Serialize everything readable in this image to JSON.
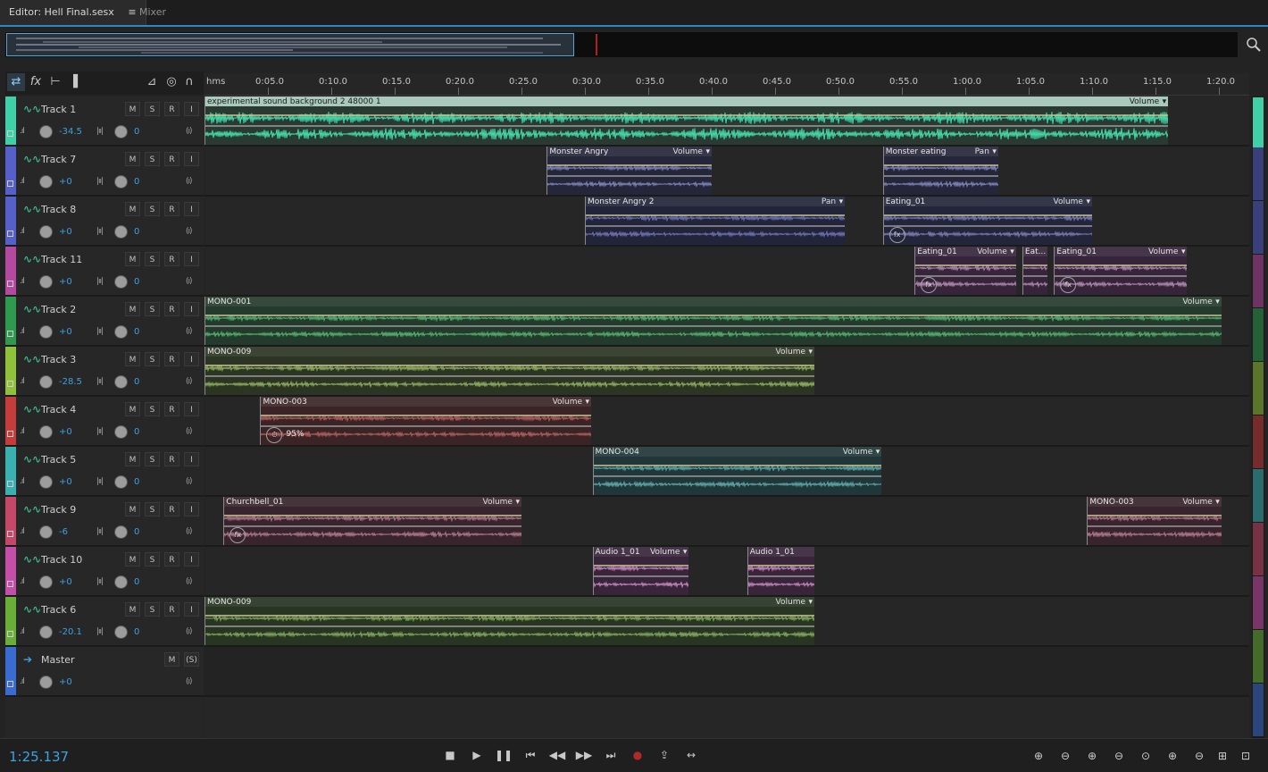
{
  "tabs": [
    {
      "label": "Editor: Hell Final.sesx",
      "active": true
    },
    {
      "label": "Mixer",
      "active": false
    }
  ],
  "tab_menu_icon": "hamburger-icon",
  "ruler": {
    "unit": "hms",
    "ticks": [
      "0:05.0",
      "0:10.0",
      "0:15.0",
      "0:20.0",
      "0:25.0",
      "0:30.0",
      "0:35.0",
      "0:40.0",
      "0:45.0",
      "0:50.0",
      "0:55.0",
      "1:00.0",
      "1:05.0",
      "1:10.0",
      "1:15.0",
      "1:20.0"
    ]
  },
  "track_header_buttons": {
    "mute": "M",
    "solo": "S",
    "record": "R",
    "input": "I"
  },
  "tracks": [
    {
      "name": "Track 1",
      "color": "#3fd0a7",
      "volume": "-34.5",
      "pan": "0",
      "clips": [
        {
          "title": "experimental sound background 2 48000 1",
          "param": "Volume",
          "start": 0.0,
          "end": 76.0,
          "fill": "#2a3a33",
          "wave": "#44dba8",
          "strong": true
        }
      ]
    },
    {
      "name": "Track 7",
      "color": "#5560c8",
      "volume": "+0",
      "pan": "0",
      "clips": [
        {
          "title": "Monster Angry",
          "param": "Volume",
          "start": 27.0,
          "end": 40.0,
          "fill": "#25263a",
          "wave": "#8286b8"
        },
        {
          "title": "Monster eating",
          "param": "Pan",
          "start": 53.5,
          "end": 62.6,
          "fill": "#25263a",
          "wave": "#8286b8"
        }
      ]
    },
    {
      "name": "Track 8",
      "color": "#5560c8",
      "volume": "+0",
      "pan": "0",
      "clips": [
        {
          "title": "Monster Angry 2",
          "param": "Pan",
          "start": 30.0,
          "end": 50.5,
          "fill": "#22243a",
          "wave": "#6e73b0"
        },
        {
          "title": "Eating_01",
          "param": "Volume",
          "start": 53.5,
          "end": 70.0,
          "fill": "#23253a",
          "wave": "#7a7eb0",
          "fx": true
        }
      ]
    },
    {
      "name": "Track 11",
      "color": "#b34aa0",
      "volume": "+0",
      "pan": "0",
      "clips": [
        {
          "title": "Eating_01",
          "param": "Volume",
          "start": 56.0,
          "end": 64.0,
          "fill": "#36253a",
          "wave": "#b08aae",
          "fx": true
        },
        {
          "title": "Eat...",
          "param": "",
          "start": 64.5,
          "end": 66.5,
          "fill": "#36253a",
          "wave": "#b08aae"
        },
        {
          "title": "Eating_01",
          "param": "Volume",
          "start": 67.0,
          "end": 77.5,
          "fill": "#36253a",
          "wave": "#b08aae",
          "fx": true
        }
      ]
    },
    {
      "name": "Track 2",
      "color": "#2f9a4f",
      "volume": "+0",
      "pan": "0",
      "clips": [
        {
          "title": "MONO-001",
          "param": "Volume",
          "start": 0.0,
          "end": 80.2,
          "fill": "#243a2c",
          "wave": "#56b072"
        }
      ]
    },
    {
      "name": "Track 3",
      "color": "#8fc23a",
      "volume": "-28.5",
      "pan": "0",
      "clips": [
        {
          "title": "MONO-009",
          "param": "Volume",
          "start": 0.0,
          "end": 48.1,
          "fill": "#2c3524",
          "wave": "#8fb060"
        }
      ]
    },
    {
      "name": "Track 4",
      "color": "#c43c3c",
      "volume": "+0",
      "pan": "0",
      "clips": [
        {
          "title": "MONO-003",
          "param": "Volume",
          "start": 4.4,
          "end": 30.5,
          "fill": "#3b2426",
          "wave": "#b06060",
          "stretch": "95%"
        }
      ]
    },
    {
      "name": "Track 5",
      "color": "#3ab0b0",
      "volume": "+0",
      "pan": "0",
      "clips": [
        {
          "title": "MONO-004",
          "param": "Volume",
          "start": 30.6,
          "end": 53.4,
          "fill": "#213638",
          "wave": "#5fa8a8"
        }
      ]
    },
    {
      "name": "Track 9",
      "color": "#c4486a",
      "volume": "-6",
      "pan": "0",
      "clips": [
        {
          "title": "Churchbell_01",
          "param": "Volume",
          "start": 1.5,
          "end": 25.0,
          "fill": "#38242c",
          "wave": "#b07888",
          "fx": true
        },
        {
          "title": "MONO-003",
          "param": "Volume",
          "start": 69.6,
          "end": 80.2,
          "fill": "#38242c",
          "wave": "#b07888"
        }
      ]
    },
    {
      "name": "Track 10",
      "color": "#c44fa8",
      "volume": "+0",
      "pan": "0",
      "clips": [
        {
          "title": "Audio 1_01",
          "param": "Volume",
          "start": 30.6,
          "end": 38.2,
          "fill": "#38253a",
          "wave": "#c88abd"
        },
        {
          "title": "Audio 1_01",
          "param": "",
          "start": 42.8,
          "end": 48.1,
          "fill": "#38253a",
          "wave": "#c88abd"
        }
      ]
    },
    {
      "name": "Track 6",
      "color": "#6aae3a",
      "volume": "-20.1",
      "pan": "0",
      "clips": [
        {
          "title": "MONO-009",
          "param": "Volume",
          "start": 0.0,
          "end": 48.1,
          "fill": "#283522",
          "wave": "#84a860"
        }
      ]
    }
  ],
  "master": {
    "name": "Master",
    "color": "#3a6bd0",
    "volume": "+0",
    "mute": "M",
    "solo": "(S)"
  },
  "timecode": "1:25.137",
  "transport_icons": [
    "stop-icon",
    "play-icon",
    "pause-icon",
    "go-to-start-icon",
    "rewind-icon",
    "fast-forward-icon",
    "go-to-end-icon",
    "record-icon",
    "loop-icon",
    "skip-icon"
  ],
  "zoom_icons": [
    "zoom-in-amplitude-icon",
    "zoom-out-amplitude-icon",
    "zoom-in-time-icon",
    "zoom-out-time-icon",
    "zoom-full-icon",
    "zoom-in-tracks-icon",
    "zoom-out-tracks-icon",
    "zoom-selection-icon",
    "zoom-all-tracks-icon",
    "zoom-reset-icon"
  ]
}
